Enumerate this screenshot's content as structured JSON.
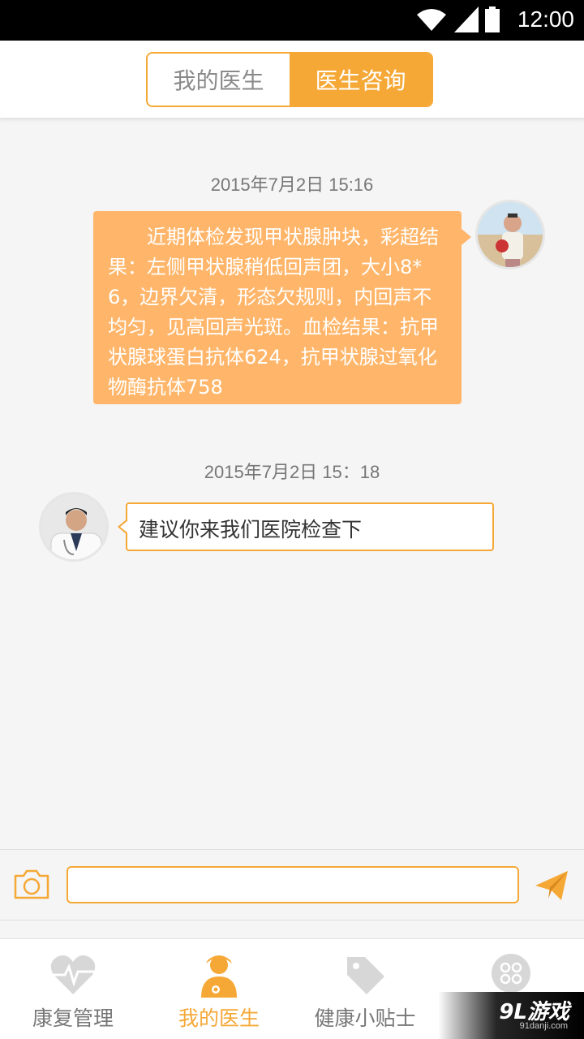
{
  "status_bar": {
    "time": "12:00"
  },
  "header": {
    "tabs": [
      {
        "label": "我的医生",
        "active": false
      },
      {
        "label": "医生咨询",
        "active": true
      }
    ]
  },
  "chat": {
    "messages": [
      {
        "timestamp": "2015年7月2日 15:16",
        "sender": "patient",
        "text": "近期体检发现甲状腺肿块，彩超结果：左侧甲状腺稍低回声团，大小8*6，边界欠清，形态欠规则，内回声不均匀，见高回声光斑。血检结果：抗甲状腺球蛋白抗体624，抗甲状腺过氧化物酶抗体758"
      },
      {
        "timestamp": "2015年7月2日  15：18",
        "sender": "doctor",
        "text": "建议你来我们医院检查下"
      }
    ]
  },
  "input_bar": {
    "placeholder": ""
  },
  "tabbar": {
    "items": [
      {
        "label": "康复管理",
        "icon": "heartbeat-icon",
        "active": false
      },
      {
        "label": "我的医生",
        "icon": "doctor-icon",
        "active": true
      },
      {
        "label": "健康小贴士",
        "icon": "tag-icon",
        "active": false
      },
      {
        "label": "",
        "icon": "command-icon",
        "active": false
      }
    ]
  },
  "watermark": {
    "main": "9L游戏",
    "sub": "91danji.com"
  },
  "colors": {
    "accent": "#f5a836",
    "bubble_out": "#ffb66a",
    "background": "#f5f5f5"
  }
}
